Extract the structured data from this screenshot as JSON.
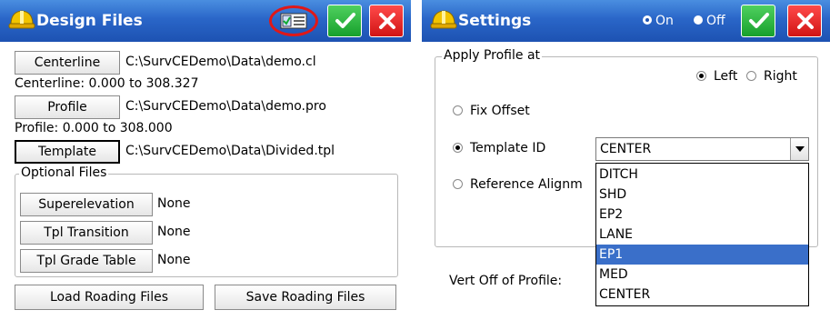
{
  "design_files": {
    "title": "Design Files",
    "centerline": {
      "button": "Centerline",
      "path": "C:\\SurvCEDemo\\Data\\demo.cl",
      "range": "Centerline: 0.000 to 308.327"
    },
    "profile": {
      "button": "Profile",
      "path": "C:\\SurvCEDemo\\Data\\demo.pro",
      "range": "Profile: 0.000 to 308.000"
    },
    "template": {
      "button": "Template",
      "path": "C:\\SurvCEDemo\\Data\\Divided.tpl"
    },
    "optional_files": {
      "legend": "Optional Files",
      "superelevation": {
        "button": "Superelevation",
        "value": "None"
      },
      "tpl_transition": {
        "button": "Tpl Transition",
        "value": "None"
      },
      "tpl_grade_table": {
        "button": "Tpl Grade Table",
        "value": "None"
      }
    },
    "load_button": "Load Roading Files",
    "save_button": "Save Roading Files"
  },
  "settings": {
    "title": "Settings",
    "on_label": "On",
    "off_label": "Off",
    "on_selected": true,
    "apply_profile": {
      "legend": "Apply Profile at",
      "left_label": "Left",
      "right_label": "Right",
      "selected": "Left",
      "fix_offset_label": "Fix Offset",
      "template_id_label": "Template ID",
      "reference_alignment_label": "Reference Alignm",
      "mode_selected": "Template ID"
    },
    "template_id_value": "CENTER",
    "dropdown_options": [
      "DITCH",
      "SHD",
      "EP2",
      "LANE",
      "EP1",
      "MED",
      "CENTER"
    ],
    "dropdown_highlighted": "EP1",
    "vert_off_label": "Vert Off of Profile:"
  },
  "colors": {
    "titlebar": "#2a66c8",
    "ok_green": "#17a02c",
    "close_red": "#d11414",
    "highlight_ring": "#e01818",
    "list_selection": "#3a6fc9"
  },
  "icons": {
    "app": "helmet-icon",
    "layers": "layer-list-icon",
    "ok": "checkmark-icon",
    "close": "close-x-icon",
    "dropdown": "chevron-down-icon"
  }
}
